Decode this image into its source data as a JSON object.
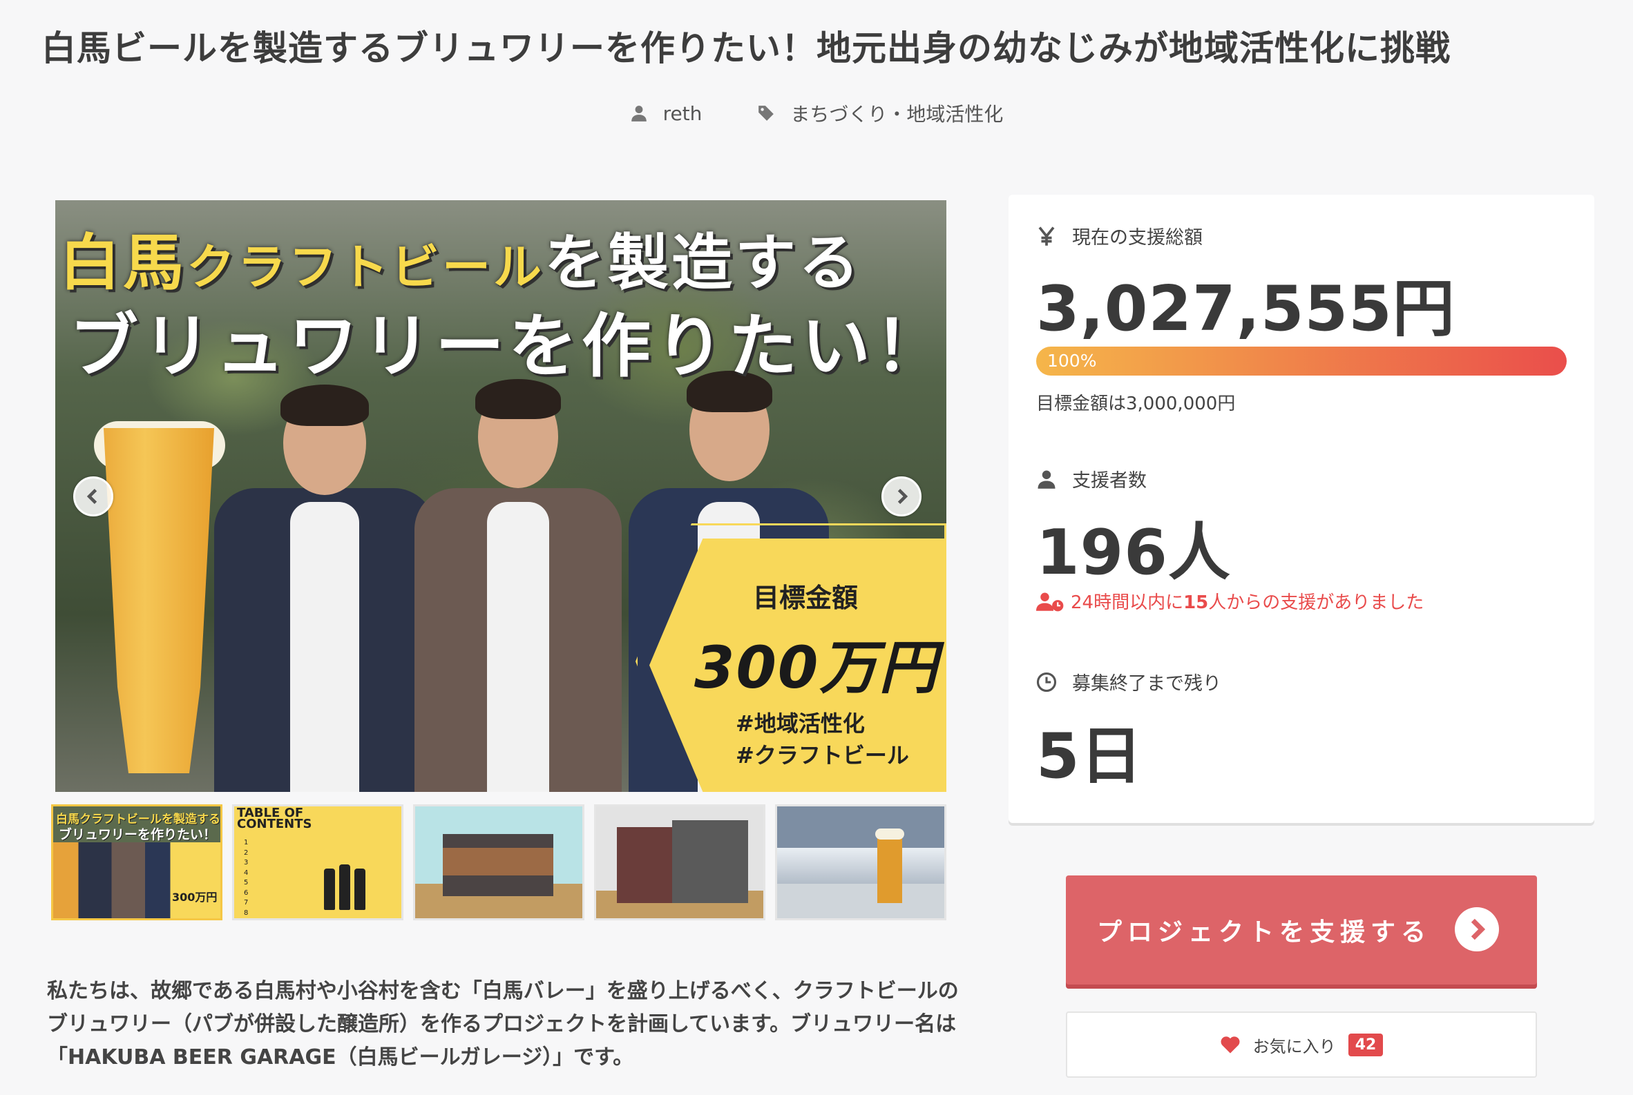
{
  "page_title": "白馬ビールを製造するブリュワリーを作りたい！地元出身の幼なじみが地域活性化に挑戦",
  "meta": {
    "author": "reth",
    "category": "まちづくり・地域活性化"
  },
  "hero": {
    "headline_yellow_1": "白馬",
    "headline_yellow_2": "クラフトビール",
    "headline_white": "を製造する",
    "headline_line2": "ブリュワリーを作りたい！",
    "goal_label": "目標金額",
    "goal_amount": "300万円",
    "tag1": "#地域活性化",
    "tag2": "#クラフトビール"
  },
  "thumbnails": [
    {
      "name": "thumb-main-visual",
      "caption_line1": "白馬クラフトビールを製造する",
      "caption_line2": "ブリュワリーを作りたい！",
      "amount": "300万円"
    },
    {
      "name": "thumb-table-of-contents",
      "heading1": "TABLE OF",
      "heading2": "CONTENTS",
      "items": [
        "1",
        "2",
        "3",
        "4",
        "5",
        "6",
        "7",
        "8"
      ]
    },
    {
      "name": "thumb-building-render-1"
    },
    {
      "name": "thumb-building-render-2"
    },
    {
      "name": "thumb-beer-mountains"
    }
  ],
  "description": "私たちは、故郷である白馬村や小谷村を含む「白馬バレー」を盛り上げるべく、クラフトビールのブリュワリー（パブが併設した醸造所）を作るプロジェクトを計画しています。ブリュワリー名は「HAKUBA BEER GARAGE（白馬ビールガレージ）」です。",
  "stats": {
    "total_label": "現在の支援総額",
    "total_amount": "3,027,555円",
    "progress_label": "100%",
    "progress_value": 1.0,
    "goal_text": "目標金額は3,000,000円",
    "backers_label": "支援者数",
    "backers_count": "196人",
    "recent_prefix": "24時間以内に",
    "recent_count": "15",
    "recent_suffix": "人からの支援がありました",
    "remaining_label": "募集終了まで残り",
    "remaining_days": "5日"
  },
  "actions": {
    "support_label": "プロジェクトを支援する",
    "favorite_label": "お気に入り",
    "favorite_count": "42"
  },
  "icons": {
    "author": "user-icon",
    "category": "tag-icon",
    "yen": "yen-icon",
    "backers": "user-icon",
    "recent": "user-clock-icon",
    "time": "clock-icon",
    "support_go": "chevron-right-circle-icon",
    "favorite": "heart-icon",
    "prev": "chevron-left-icon",
    "next": "chevron-right-icon"
  },
  "colors": {
    "accent_red": "#dd6468",
    "progress_start": "#f5b64a",
    "progress_end": "#ea4e4b",
    "recent_red": "#e94b4b",
    "goal_yellow": "#f8d85a"
  }
}
